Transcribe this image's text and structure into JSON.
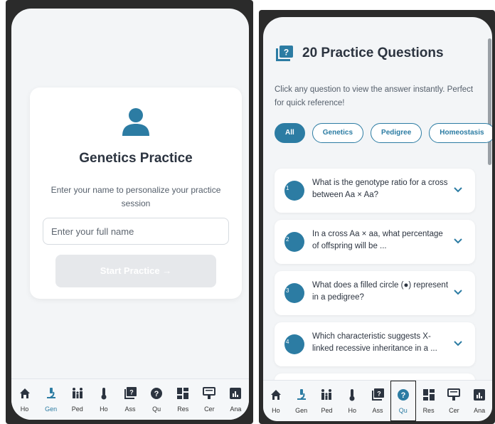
{
  "left": {
    "card": {
      "title": "Genetics Practice",
      "subtitle": "Enter your name to personalize your practice session",
      "name_placeholder": "Enter your full name",
      "start_label": "Start Practice →"
    },
    "nav": [
      {
        "label": "Ho",
        "icon": "home-icon"
      },
      {
        "label": "Gen",
        "icon": "microscope-icon",
        "active": true
      },
      {
        "label": "Ped",
        "icon": "family-icon"
      },
      {
        "label": "Ho",
        "icon": "thermometer-icon"
      },
      {
        "label": "Ass",
        "icon": "question-book-icon"
      },
      {
        "label": "Qu",
        "icon": "question-circle-icon"
      },
      {
        "label": "Res",
        "icon": "dashboard-icon"
      },
      {
        "label": "Cer",
        "icon": "certificate-icon"
      },
      {
        "label": "Ana",
        "icon": "chart-icon"
      }
    ]
  },
  "right": {
    "header": {
      "title": "20 Practice Questions",
      "description": "Click any question to view the answer instantly. Perfect for quick reference!"
    },
    "filters": [
      "All",
      "Genetics",
      "Pedigree",
      "Homeostasis"
    ],
    "questions": [
      {
        "num": "1",
        "text": "What is the genotype ratio for a cross between Aa × Aa?"
      },
      {
        "num": "2",
        "text": "In a cross Aa × aa, what percentage of offspring will be ..."
      },
      {
        "num": "3",
        "text": "What does a filled circle (●) represent in a pedigree?"
      },
      {
        "num": "4",
        "text": "Which characteristic suggests X-linked recessive inheritance in a ..."
      }
    ],
    "nav": [
      {
        "label": "Ho",
        "icon": "home-icon"
      },
      {
        "label": "Gen",
        "icon": "microscope-icon"
      },
      {
        "label": "Ped",
        "icon": "family-icon"
      },
      {
        "label": "Ho",
        "icon": "thermometer-icon"
      },
      {
        "label": "Ass",
        "icon": "question-book-icon"
      },
      {
        "label": "Qu",
        "icon": "question-circle-icon",
        "active": true
      },
      {
        "label": "Res",
        "icon": "dashboard-icon"
      },
      {
        "label": "Cer",
        "icon": "certificate-icon"
      },
      {
        "label": "Ana",
        "icon": "chart-icon"
      }
    ]
  },
  "colors": {
    "accent": "#2c7ca3",
    "text": "#2c3440",
    "muted": "#555f6b",
    "disabled": "#e6e8eb"
  }
}
